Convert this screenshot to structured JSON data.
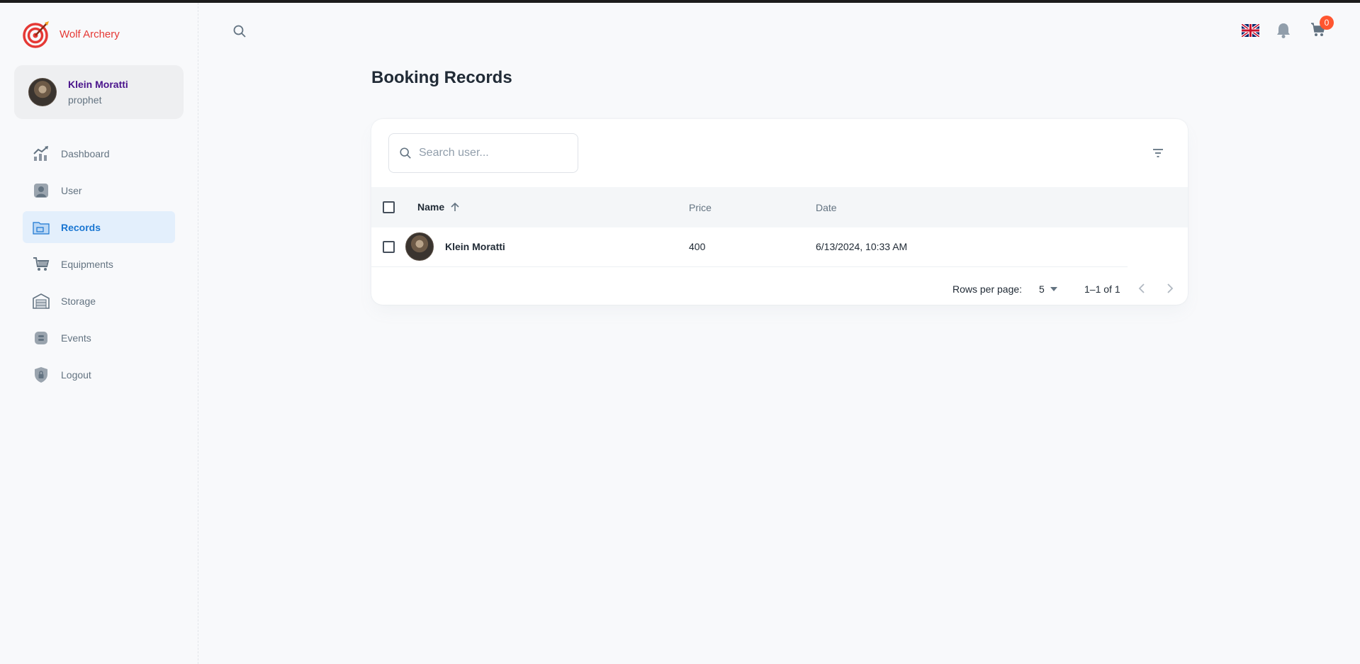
{
  "brand": {
    "name": "Wolf Archery"
  },
  "account": {
    "name": "Klein Moratti",
    "role": "prophet"
  },
  "nav": {
    "items": [
      {
        "label": "Dashboard",
        "icon": "chart-icon"
      },
      {
        "label": "User",
        "icon": "user-icon"
      },
      {
        "label": "Records",
        "icon": "folder-icon",
        "active": true
      },
      {
        "label": "Equipments",
        "icon": "cart-icon"
      },
      {
        "label": "Storage",
        "icon": "warehouse-icon"
      },
      {
        "label": "Events",
        "icon": "blog-icon"
      },
      {
        "label": "Logout",
        "icon": "lock-shield-icon"
      }
    ]
  },
  "header": {
    "cart_count": "0"
  },
  "page": {
    "title": "Booking Records"
  },
  "table": {
    "search_placeholder": "Search user...",
    "columns": {
      "name": "Name",
      "price": "Price",
      "date": "Date"
    },
    "rows": [
      {
        "name": "Klein Moratti",
        "price": "400",
        "date": "6/13/2024, 10:33 AM"
      }
    ],
    "pagination": {
      "rows_per_page_label": "Rows per page:",
      "rows_per_page": "5",
      "range": "1–1 of 1"
    }
  },
  "colors": {
    "brand_red": "#e53935",
    "active_blue": "#1976d2",
    "badge": "#ff5630"
  }
}
